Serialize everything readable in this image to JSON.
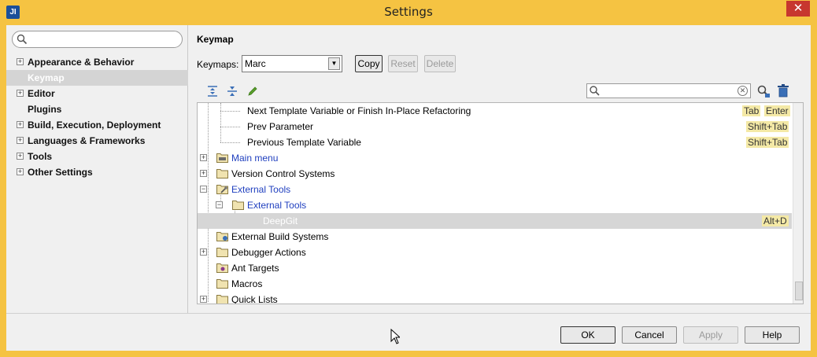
{
  "window": {
    "title": "Settings",
    "app_icon": "JI",
    "close_label": "✕"
  },
  "sidebar": {
    "search_placeholder": "",
    "items": [
      {
        "label": "Appearance & Behavior",
        "expandable": true
      },
      {
        "label": "Keymap",
        "expandable": false,
        "selected": true
      },
      {
        "label": "Editor",
        "expandable": true
      },
      {
        "label": "Plugins",
        "expandable": false
      },
      {
        "label": "Build, Execution, Deployment",
        "expandable": true
      },
      {
        "label": "Languages & Frameworks",
        "expandable": true
      },
      {
        "label": "Tools",
        "expandable": true
      },
      {
        "label": "Other Settings",
        "expandable": true
      }
    ]
  },
  "panel": {
    "title": "Keymap",
    "keymaps_label": "Keymaps:",
    "keymap_value": "Marc",
    "copy_label": "Copy",
    "reset_label": "Reset",
    "delete_label": "Delete",
    "filter_value": ""
  },
  "tree": {
    "rows": [
      {
        "label": "Next Template Variable or Finish In-Place Refactoring",
        "shortcuts": [
          "Tab",
          "Enter"
        ]
      },
      {
        "label": "Prev Parameter",
        "shortcuts": [
          "Shift+Tab"
        ]
      },
      {
        "label": "Previous Template Variable",
        "shortcuts": [
          "Shift+Tab"
        ]
      },
      {
        "label": "Main menu",
        "shortcuts": [],
        "blue": true
      },
      {
        "label": "Version Control Systems",
        "shortcuts": []
      },
      {
        "label": "External Tools",
        "shortcuts": [],
        "blue": true
      },
      {
        "label": "External Tools",
        "shortcuts": [],
        "blue": true
      },
      {
        "label": "DeepGit",
        "shortcuts": [
          "Alt+D"
        ],
        "selected": true
      },
      {
        "label": "External Build Systems",
        "shortcuts": []
      },
      {
        "label": "Debugger Actions",
        "shortcuts": []
      },
      {
        "label": "Ant Targets",
        "shortcuts": []
      },
      {
        "label": "Macros",
        "shortcuts": []
      },
      {
        "label": "Quick Lists",
        "shortcuts": []
      }
    ]
  },
  "footer": {
    "ok_label": "OK",
    "cancel_label": "Cancel",
    "apply_label": "Apply",
    "help_label": "Help"
  },
  "icons": {
    "search": "search-icon",
    "expand_all": "expand-all-icon",
    "collapse_all": "collapse-all-icon",
    "edit": "pencil-icon",
    "find_shortcut": "find-shortcut-icon",
    "clear_filter": "trash-icon"
  },
  "colors": {
    "title_bar": "#f5c342",
    "close_button": "#c7372f",
    "shortcut_bg": "#f4e9a6",
    "link_blue": "#1f3fbf",
    "selection": "#d4d4d4"
  }
}
